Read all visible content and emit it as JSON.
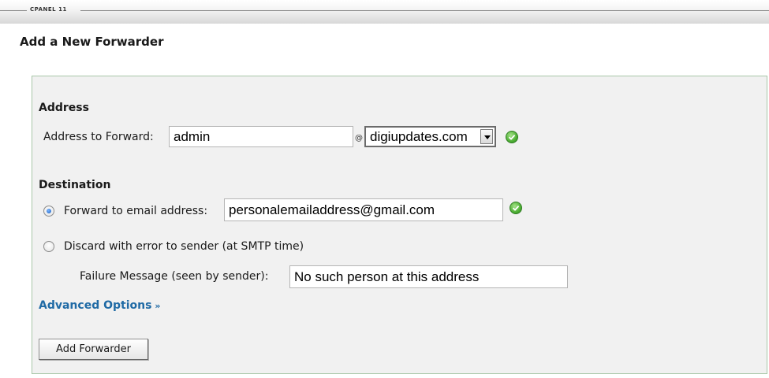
{
  "header": {
    "brand": "CPANEL 11"
  },
  "page": {
    "title": "Add a New Forwarder"
  },
  "address": {
    "section_title": "Address",
    "label": "Address to Forward:",
    "value": "admin",
    "at_symbol": "@",
    "domain_selected": "digiupdates.com",
    "valid_icon": "green-check-icon"
  },
  "destination": {
    "section_title": "Destination",
    "forward_option_label": "Forward to email address:",
    "forward_value": "personalemailaddress@gmail.com",
    "forward_selected": true,
    "discard_option_label": "Discard with error to sender (at SMTP time)",
    "discard_selected": false,
    "failure_label": "Failure Message (seen by sender):",
    "failure_value": "No such person at this address",
    "valid_icon": "green-check-icon"
  },
  "advanced": {
    "label": "Advanced Options",
    "chevron": "»"
  },
  "actions": {
    "submit_label": "Add Forwarder"
  },
  "colors": {
    "panel_bg": "#f1f1f1",
    "panel_border": "#a9c7a8",
    "link": "#1f6aa5",
    "success": "#4fb035"
  }
}
